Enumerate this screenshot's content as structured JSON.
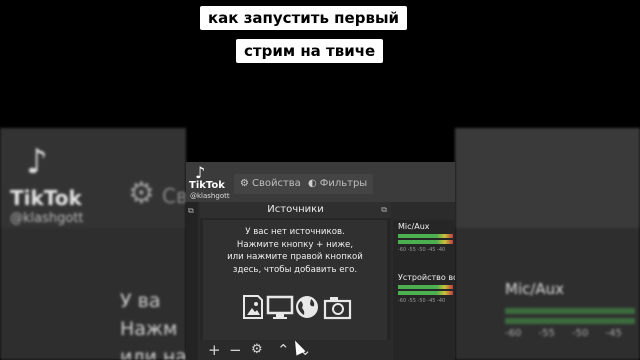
{
  "caption": {
    "line1": "как запустить первый",
    "line2": "стрим на твиче"
  },
  "watermark": {
    "brand": "TikTok",
    "username": "@klashgott"
  },
  "tabs": [
    {
      "label": "Свойства",
      "icon": "gear-icon"
    },
    {
      "label": "Фильтры",
      "icon": "filter-icon"
    }
  ],
  "sources": {
    "title": "Источники",
    "empty_line1": "У вас нет источников.",
    "empty_line2": "Нажмите кнопку + ниже,",
    "empty_line3": "или нажмите правой кнопкой",
    "empty_line4": "здесь, чтобы добавить его.",
    "icons": [
      "image-icon",
      "display-icon",
      "globe-icon",
      "camera-icon"
    ],
    "toolbar": [
      {
        "symbol": "+",
        "name": "add-source-button"
      },
      {
        "symbol": "−",
        "name": "remove-source-button"
      },
      {
        "symbol": "⚙",
        "name": "source-settings-button"
      },
      {
        "symbol": "⌃",
        "name": "move-up-button"
      },
      {
        "symbol": "⌄",
        "name": "move-down-button"
      }
    ]
  },
  "mixer": {
    "channels": [
      {
        "label": "Mic/Aux"
      },
      {
        "label": "Устройство вос"
      }
    ],
    "scale": "-60 -55 -50 -45 -40"
  },
  "background": {
    "left_text_line1": "У ва",
    "left_text_line2": "Нажм",
    "left_text_line3": "или нажми",
    "left_gear_text": "Сво",
    "right_label": "Mic/Aux",
    "right_scale": "-60 -55 -50 -45"
  }
}
